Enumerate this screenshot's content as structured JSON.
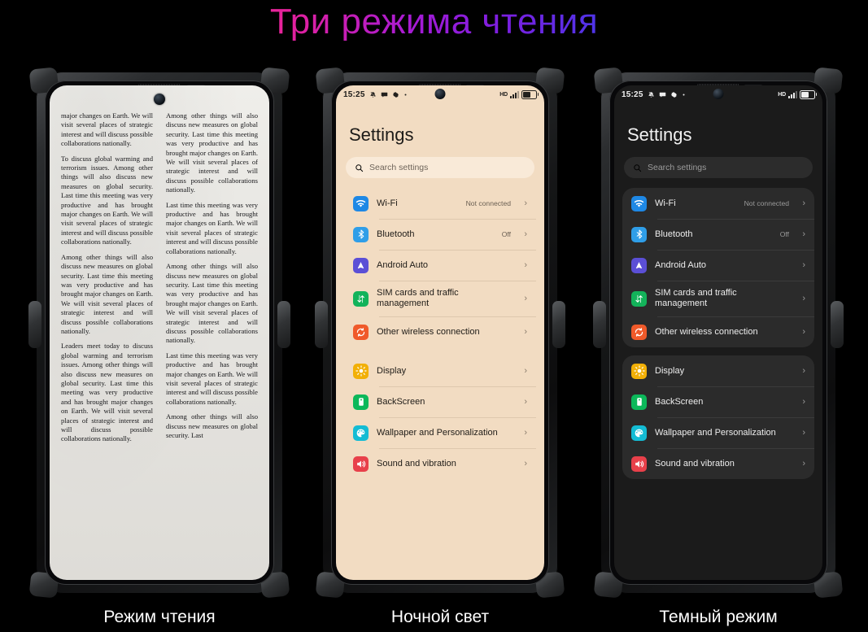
{
  "title": "Три режима чтения",
  "title_gradient": [
    "#ff8a12",
    "#ee3d8b",
    "#a41bd6",
    "#2b8cf5"
  ],
  "captions": {
    "reading": "Режим чтения",
    "night": "Ночной свет",
    "dark": "Темный режим"
  },
  "reading_mode": {
    "paragraphs": [
      "major changes on Earth. We will visit several places of strategic interest and will discuss possible collaborations nationally.",
      "To discuss global warming and terrorism issues. Among other things will also discuss new measures on global security. Last time this meeting was very productive and has brought major changes on Earth. We will visit several places of strategic interest and will discuss possible collaborations nationally.",
      "Among other things will also discuss new measures on global security. Last time this meeting was very productive and has brought major changes on Earth. We will visit several places of strategic interest and will discuss possible collaborations nationally.",
      "Leaders meet today to discuss global warming and terrorism issues. Among other things will also discuss new measures on global security. Last time this meeting was very productive and has brought major changes on Earth. We will visit several places of strategic interest and will discuss possible collaborations nationally.",
      "Among other things will also discuss new measures on global security. Last time this meeting was very productive and has brought major changes on Earth. We will visit several places of strategic interest and will discuss possible collaborations nationally.",
      "Last time this meeting was very productive and has brought major changes on Earth. We will visit several places of strategic interest and will discuss possible collaborations nationally.",
      "Among other things will also discuss new measures on global security. Last time this meeting was very productive and has brought major changes on Earth. We will visit several places of strategic interest and will discuss possible collaborations nationally.",
      "Last time this meeting was very productive and has brought major changes on Earth. We will visit several places of strategic interest and will discuss possible collaborations nationally.",
      "Among other things will also discuss new measures on global security. Last"
    ]
  },
  "statusbar": {
    "time": "15:25",
    "icons_left": [
      "mute-icon",
      "message-icon",
      "gear-icon",
      "dot-icon"
    ],
    "network_label": "HD",
    "signal_bars": 3,
    "battery_percent": 55
  },
  "settings": {
    "page_title": "Settings",
    "search_placeholder": "Search settings",
    "groups": [
      {
        "items": [
          {
            "label": "Wi-Fi",
            "value": "Not connected",
            "icon": "wifi-icon",
            "color": "#1e88e5",
            "tall": false
          },
          {
            "label": "Bluetooth",
            "value": "Off",
            "icon": "bluetooth-icon",
            "color": "#2f9ee8",
            "tall": false
          },
          {
            "label": "Android Auto",
            "value": "",
            "icon": "android-auto-icon",
            "color": "#5b4fd6",
            "tall": false
          },
          {
            "label": "SIM cards and traffic management",
            "value": "",
            "icon": "sim-cards-icon",
            "color": "#13b35a",
            "tall": true
          },
          {
            "label": "Other wireless connection",
            "value": "",
            "icon": "other-wireless-icon",
            "color": "#f05a2a",
            "tall": false
          }
        ]
      },
      {
        "items": [
          {
            "label": "Display",
            "value": "",
            "icon": "display-icon",
            "color": "#f2b007",
            "tall": false
          },
          {
            "label": "BackScreen",
            "value": "",
            "icon": "backscreen-icon",
            "color": "#0cb85a",
            "tall": false
          },
          {
            "label": "Wallpaper and Personalization",
            "value": "",
            "icon": "wallpaper-icon",
            "color": "#14bcd4",
            "tall": false
          },
          {
            "label": "Sound and vibration",
            "value": "",
            "icon": "sound-icon",
            "color": "#e8404a",
            "tall": false
          }
        ]
      }
    ],
    "chevron": "›"
  }
}
